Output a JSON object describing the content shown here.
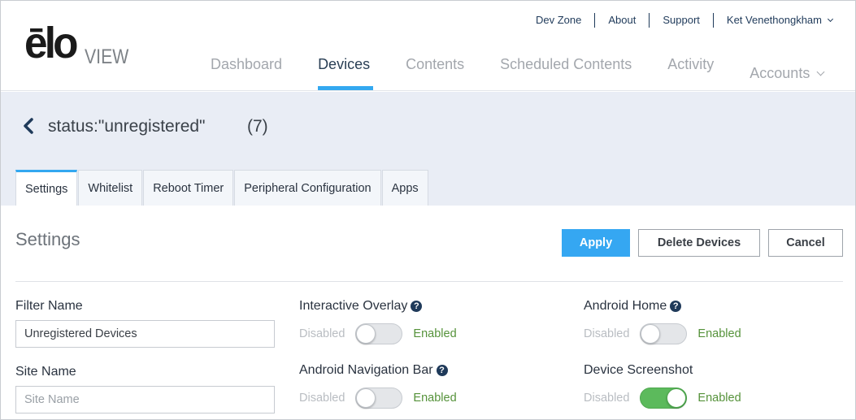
{
  "brand": {
    "logo_main": "ēlo",
    "logo_sub": "VIEW"
  },
  "utility_nav": {
    "items": [
      "Dev Zone",
      "About",
      "Support"
    ],
    "user": "Ket Venethongkham"
  },
  "main_nav": {
    "items": [
      "Dashboard",
      "Devices",
      "Contents",
      "Scheduled Contents",
      "Activity",
      "Accounts"
    ],
    "active": "Devices"
  },
  "filter": {
    "title": "status:\"unregistered\"",
    "count": "(7)"
  },
  "tabs": [
    "Settings",
    "Whitelist",
    "Reboot Timer",
    "Peripheral Configuration",
    "Apps"
  ],
  "settings": {
    "title": "Settings",
    "apply_label": "Apply",
    "delete_label": "Delete Devices",
    "cancel_label": "Cancel",
    "filter_name_label": "Filter Name",
    "filter_name_value": "Unregistered Devices",
    "site_name_label": "Site Name",
    "site_name_placeholder": "Site Name",
    "toggles": [
      {
        "label": "Interactive Overlay",
        "help": true,
        "disabled_text": "Disabled",
        "enabled_text": "Enabled",
        "on": false
      },
      {
        "label": "Android Home",
        "help": true,
        "disabled_text": "Disabled",
        "enabled_text": "Enabled",
        "on": false
      },
      {
        "label": "Android Navigation Bar",
        "help": true,
        "disabled_text": "Disabled",
        "enabled_text": "Enabled",
        "on": false
      },
      {
        "label": "Device Screenshot",
        "help": false,
        "disabled_text": "Disabled",
        "enabled_text": "Enabled",
        "on": true
      }
    ]
  },
  "icons": {
    "back": "chevron-left-icon",
    "help": "question-circle-icon",
    "dropdown": "chevron-down-icon"
  },
  "colors": {
    "accent": "#35a7f2",
    "toggle_on": "#5cba5c",
    "enabled_text": "#55923a",
    "nav_dark": "#1f3a5a",
    "band": "#e9edf5"
  }
}
